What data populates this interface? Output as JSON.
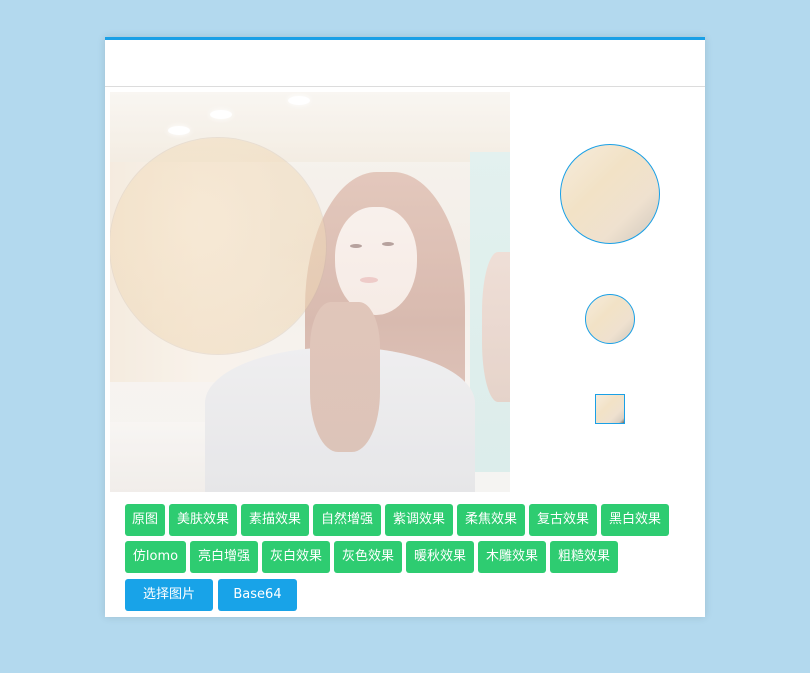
{
  "panel": {
    "title": ""
  },
  "filters": {
    "row1": [
      "原图",
      "美肤效果",
      "素描效果",
      "自然增强",
      "紫调效果",
      "柔焦效果",
      "复古效果",
      "黑白效果"
    ],
    "row2": [
      "仿lomo",
      "亮白增强",
      "灰白效果",
      "灰色效果",
      "暖秋效果",
      "木雕效果",
      "粗糙效果"
    ]
  },
  "actions": {
    "select_image": "选择图片",
    "base64": "Base64"
  },
  "colors": {
    "page_bg": "#b3d9ee",
    "accent": "#1aa0e6",
    "filter_button": "#2ecc71",
    "action_button": "#18a3e8"
  }
}
